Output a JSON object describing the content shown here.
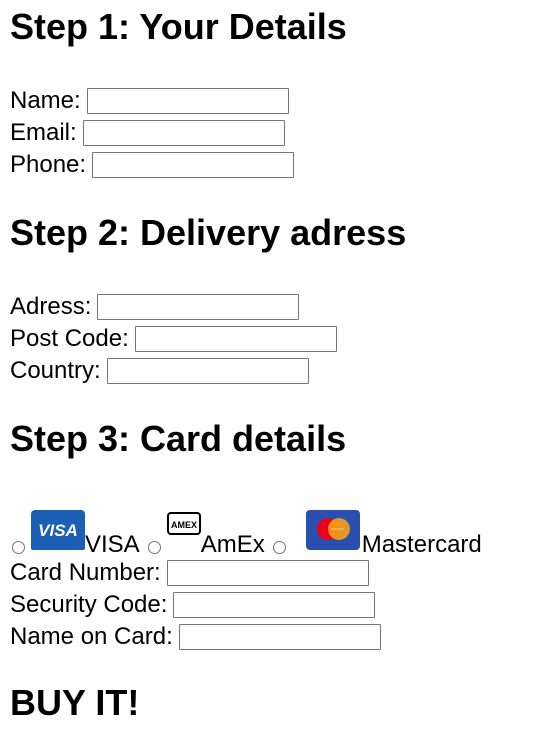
{
  "step1": {
    "heading": "Step 1: Your Details",
    "fields": [
      {
        "label": "Name:",
        "value": ""
      },
      {
        "label": "Email:",
        "value": ""
      },
      {
        "label": "Phone:",
        "value": ""
      }
    ]
  },
  "step2": {
    "heading": "Step 2: Delivery adress",
    "fields": [
      {
        "label": "Adress:",
        "value": ""
      },
      {
        "label": "Post Code:",
        "value": ""
      },
      {
        "label": "Country:",
        "value": ""
      }
    ]
  },
  "step3": {
    "heading": "Step 3: Card details",
    "card_options": [
      {
        "label": "VISA",
        "icon": "visa-logo-icon",
        "selected": false
      },
      {
        "label": "AmEx",
        "icon": "amex-logo-icon",
        "selected": false
      },
      {
        "label": "Mastercard",
        "icon": "mastercard-logo-icon",
        "selected": false
      }
    ],
    "fields": [
      {
        "label": "Card Number:",
        "value": ""
      },
      {
        "label": "Security Code:",
        "value": ""
      },
      {
        "label": "Name on Card:",
        "value": ""
      }
    ]
  },
  "buy": {
    "label": "BUY IT!"
  },
  "colors": {
    "visa_blue": "#1a5fb4",
    "mastercard_red": "#eb001b",
    "mastercard_orange": "#f79e1b",
    "mastercard_bg": "#2b4fae"
  }
}
